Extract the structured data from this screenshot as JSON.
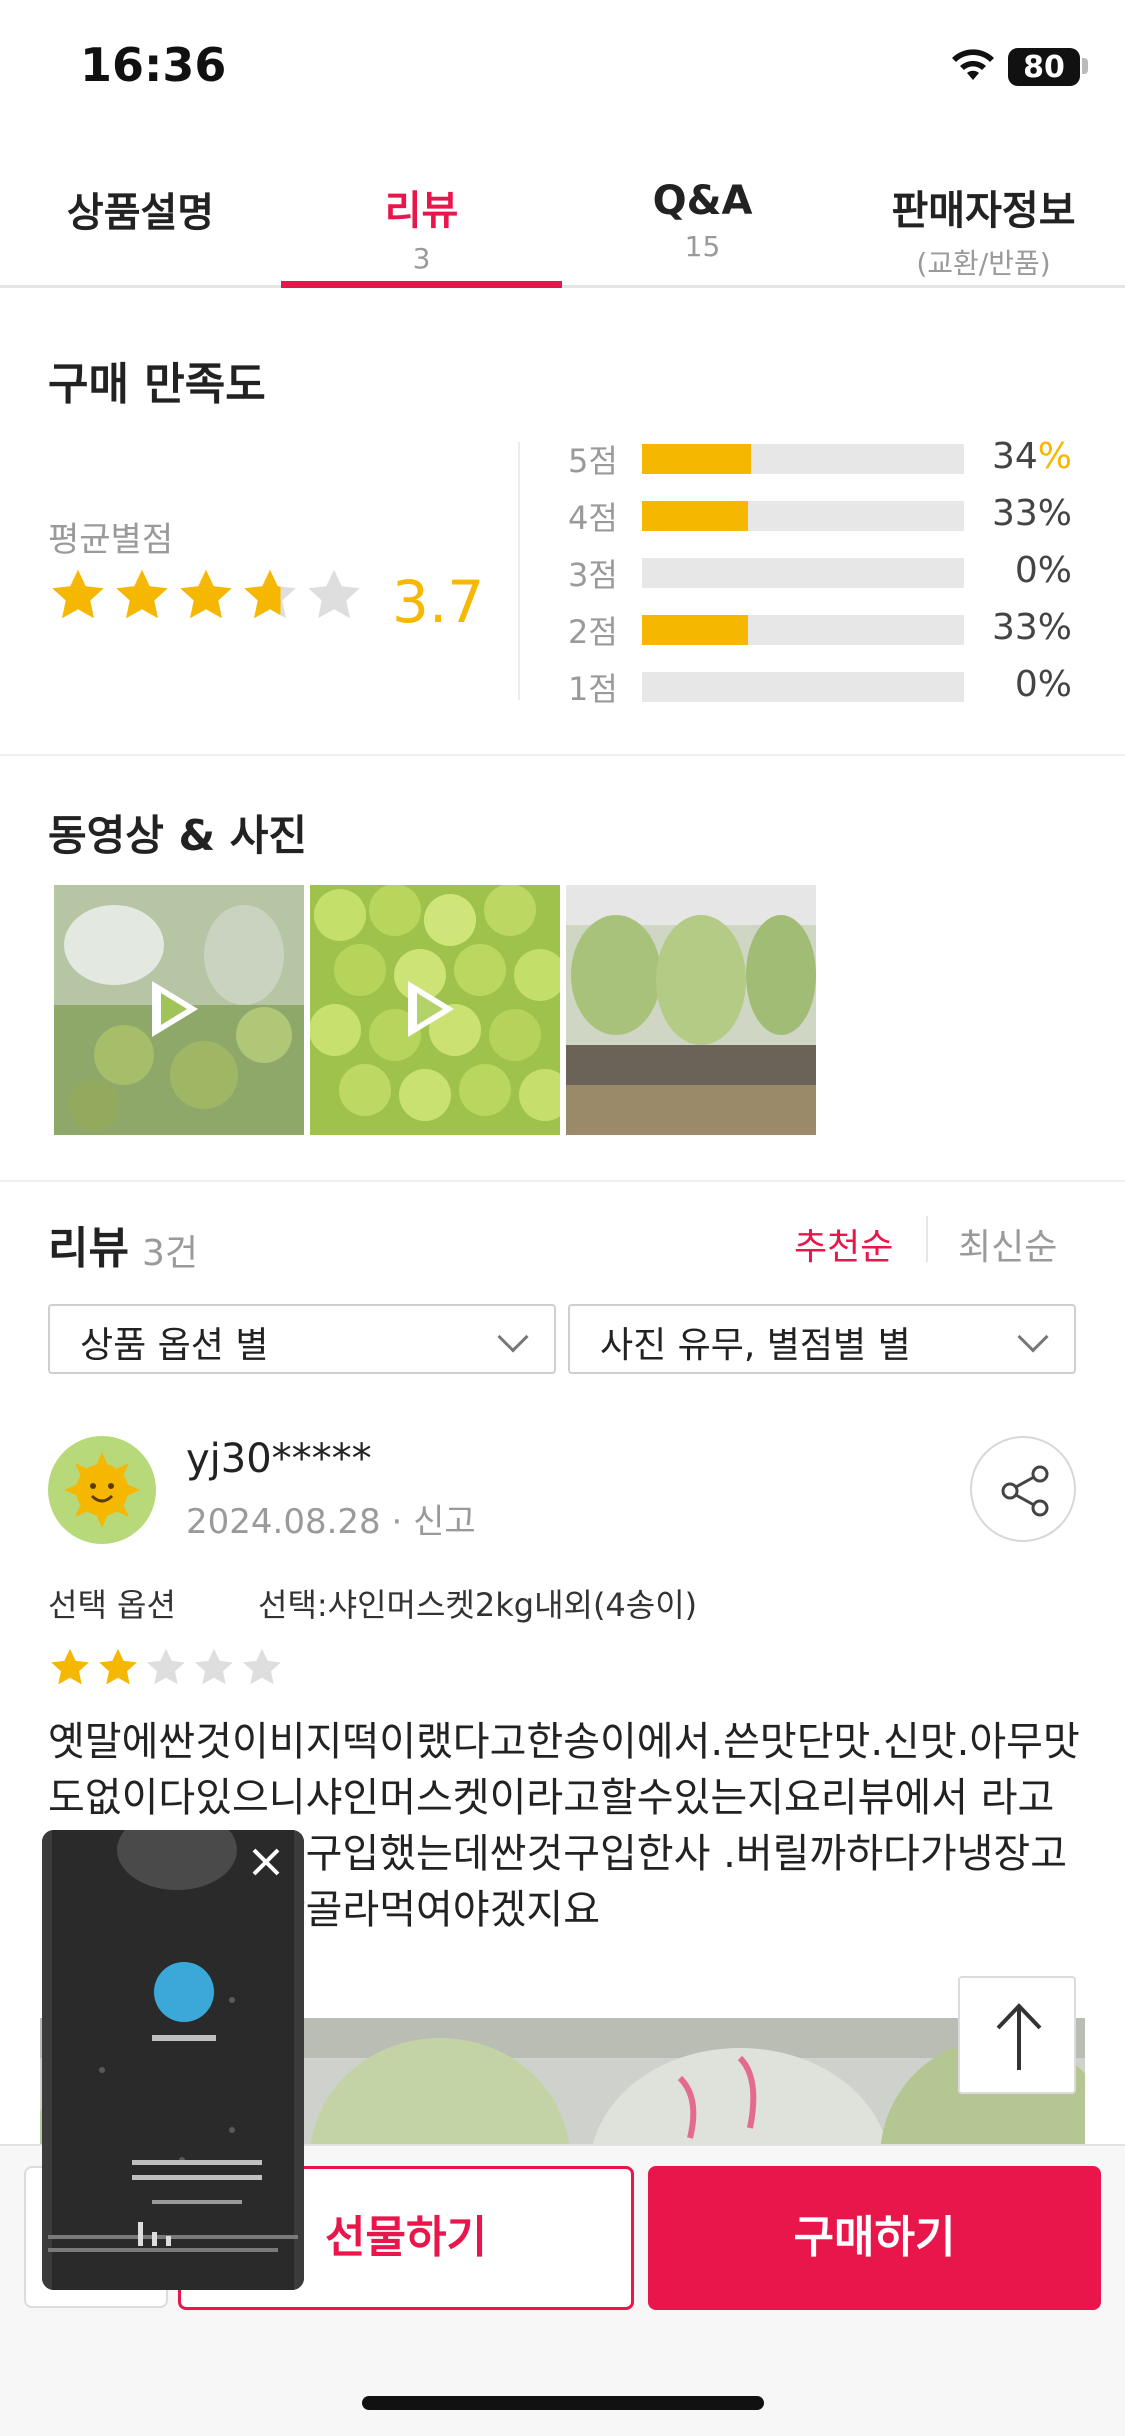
{
  "status_bar": {
    "time": "16:36",
    "battery": "80"
  },
  "tabs": [
    {
      "label": "상품설명",
      "count": ""
    },
    {
      "label": "리뷰",
      "count": "3"
    },
    {
      "label": "Q&A",
      "count": "15"
    },
    {
      "label": "판매자정보",
      "count": "(교환/반품)"
    }
  ],
  "satisfaction": {
    "title": "구매 만족도",
    "average_label": "평균별점",
    "average_value": "3.7",
    "average_rating": 3.7,
    "distribution": [
      {
        "label": "5점",
        "percent": 34,
        "value_text": "34",
        "percent_sign": "%"
      },
      {
        "label": "4점",
        "percent": 33,
        "value_text": "33%",
        "percent_sign": ""
      },
      {
        "label": "3점",
        "percent": 0,
        "value_text": "0%",
        "percent_sign": ""
      },
      {
        "label": "2점",
        "percent": 33,
        "value_text": "33%",
        "percent_sign": ""
      },
      {
        "label": "1점",
        "percent": 0,
        "value_text": "0%",
        "percent_sign": ""
      }
    ]
  },
  "media": {
    "title": "동영상 & 사진",
    "items": [
      {
        "type": "video",
        "icon": "play-icon"
      },
      {
        "type": "video",
        "icon": "play-icon"
      },
      {
        "type": "photo"
      }
    ]
  },
  "reviews": {
    "title": "리뷰",
    "count": "3건",
    "sort_recommended": "추천순",
    "sort_latest": "최신순",
    "filter_option": "상품 옵션 별",
    "filter_photo": "사진 유무, 별점별 별",
    "item": {
      "username": "yj30*****",
      "date": "2024.08.28",
      "report": "신고",
      "option_label": "선택 옵션",
      "option_value": "선택:샤인머스켓2kg내외(4송이)",
      "rating": 2,
      "body": "옛말에싼것이비지떡이랬다고한송이에서.쓴맛단맛.신맛.아무맛도없이다있으니샤인머스켓이라고할수있는지요리뷰에서 라고좋은말만있기에구입했는데싼것구입한사 .버릴까하다가냉장고에보관중단것만골라먹여야겠지요"
    }
  },
  "bottom_bar": {
    "gift_label": "선물하기",
    "buy_label": "구매하기"
  },
  "colors": {
    "accent": "#e8164a",
    "star": "#f5b700",
    "bar_bg": "#e7e7e7"
  }
}
